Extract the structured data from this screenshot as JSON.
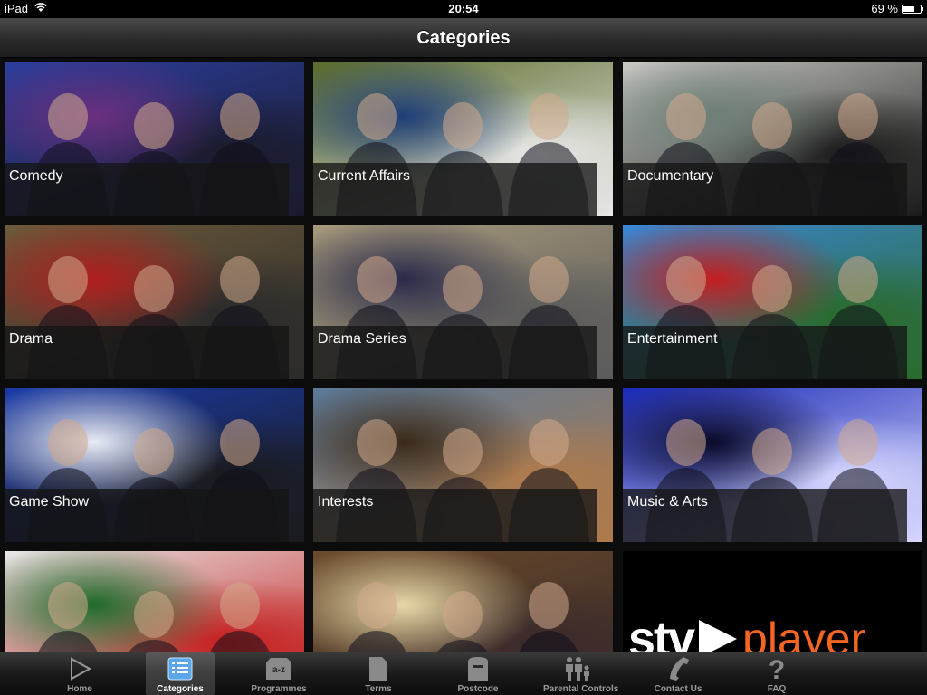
{
  "status_bar": {
    "device": "iPad",
    "time": "20:54",
    "battery_percent": "69 %",
    "battery_level": 0.69
  },
  "nav": {
    "title": "Categories"
  },
  "categories": [
    {
      "label": "Comedy",
      "colors": [
        "#2b3e9e",
        "#6b2f7e",
        "#1a1a2a"
      ]
    },
    {
      "label": "Current Affairs",
      "colors": [
        "#5a6b2a",
        "#1e3e78",
        "#e8e8e8"
      ]
    },
    {
      "label": "Documentary",
      "colors": [
        "#c9c9c4",
        "#6d7f76",
        "#1a1a1a"
      ]
    },
    {
      "label": "Drama",
      "colors": [
        "#6d5a3a",
        "#b21e1e",
        "#2a2a2a"
      ]
    },
    {
      "label": "Drama Series",
      "colors": [
        "#a89a7c",
        "#2a2a4a",
        "#5a5a5a"
      ]
    },
    {
      "label": "Entertainment",
      "colors": [
        "#3a86d6",
        "#c41e1e",
        "#2a6a2a"
      ]
    },
    {
      "label": "Game Show",
      "colors": [
        "#1a3aa8",
        "#e9ecf5",
        "#1a1a1a"
      ]
    },
    {
      "label": "Interests",
      "colors": [
        "#5a7a9a",
        "#3a2a1a",
        "#b07a4a"
      ]
    },
    {
      "label": "Music & Arts",
      "colors": [
        "#1a2ab8",
        "#0a0a2a",
        "#d8d8ff"
      ]
    },
    {
      "label": "",
      "colors": [
        "#e8e8e8",
        "#1e6a2a",
        "#c41e1e"
      ]
    },
    {
      "label": "",
      "colors": [
        "#6a4a2a",
        "#e8d8a8",
        "#3a2a2a"
      ]
    },
    {
      "label": "",
      "logo_text": "stv",
      "logo_suffix": "player",
      "colors": [
        "#000000",
        "#ffffff",
        "#f26522"
      ]
    }
  ],
  "tabs": [
    {
      "label": "Home",
      "icon": "play-icon",
      "active": false
    },
    {
      "label": "Categories",
      "icon": "list-icon",
      "active": true
    },
    {
      "label": "Programmes",
      "icon": "a-z-icon",
      "active": false
    },
    {
      "label": "Terms",
      "icon": "document-icon",
      "active": false
    },
    {
      "label": "Postcode",
      "icon": "postbox-icon",
      "active": false
    },
    {
      "label": "Parental Controls",
      "icon": "family-icon",
      "active": false
    },
    {
      "label": "Contact Us",
      "icon": "phone-icon",
      "active": false
    },
    {
      "label": "FAQ",
      "icon": "question-icon",
      "active": false
    }
  ],
  "programmes_icon_text": "a-z"
}
